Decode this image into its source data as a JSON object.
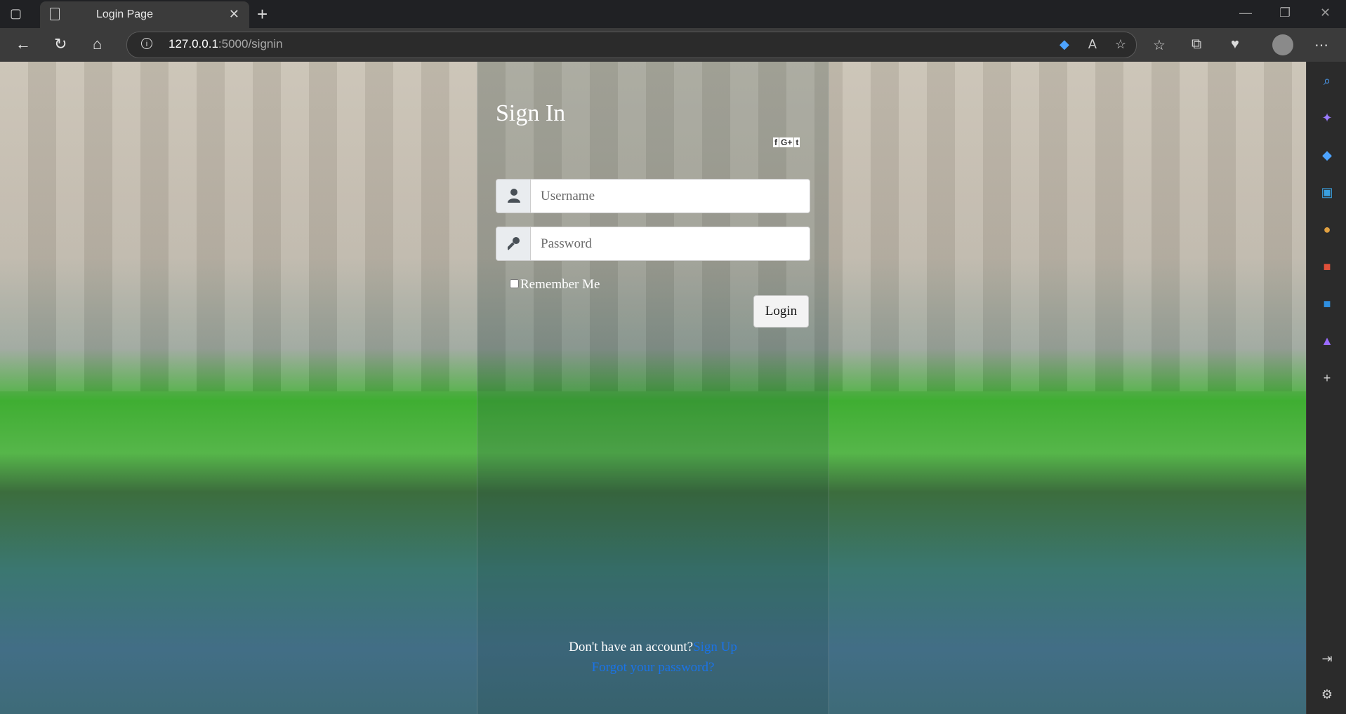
{
  "browser": {
    "tab_title": "Login Page",
    "url_host": "127.0.0.1",
    "url_rest": ":5000/signin"
  },
  "form": {
    "title": "Sign In",
    "social_labels": [
      "f",
      "G+",
      "t"
    ],
    "username_placeholder": "Username",
    "password_placeholder": "Password",
    "remember_label": "Remember Me",
    "login_label": "Login",
    "no_account_text": "Don't have an account?",
    "signup_label": "Sign Up",
    "forgot_label": "Forgot your password?"
  },
  "icons": {
    "sidebar": [
      "search-icon",
      "copilot-icon",
      "shopping-icon",
      "tools-icon",
      "games-icon",
      "office-icon",
      "outlook-icon",
      "designer-icon",
      "add-icon"
    ],
    "sidebar_bottom": [
      "sidebar-toggle-icon",
      "settings-icon"
    ]
  },
  "colors": {
    "link": "#1a73e8",
    "panel_text": "#ffffff"
  }
}
